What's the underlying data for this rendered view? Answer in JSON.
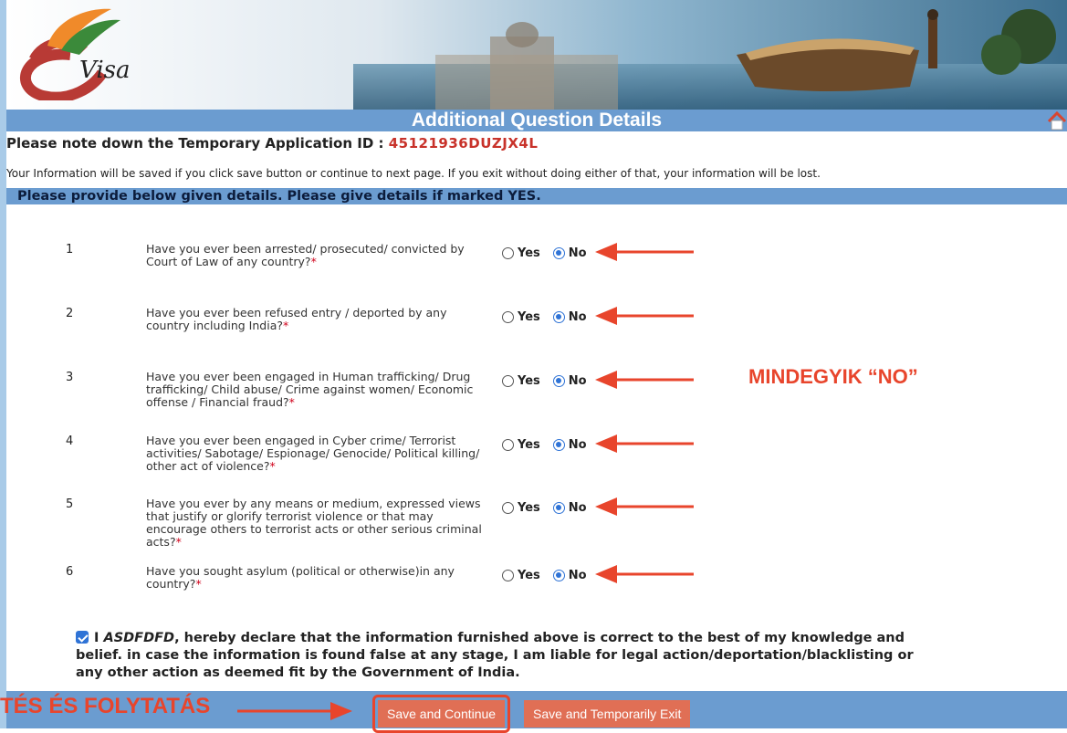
{
  "header": {
    "logo_text": "Visa",
    "title": "Additional Question Details"
  },
  "application": {
    "label": "Please note down the Temporary Application ID :",
    "id": "45121936DUZJX4L"
  },
  "info_note": "Your Information will be saved if you click save button or continue to next page. If you exit without doing either of that, your information will be lost.",
  "section_title": "Please provide below given details. Please give details if marked YES.",
  "options": {
    "yes": "Yes",
    "no": "No"
  },
  "questions": [
    {
      "num": "1",
      "text": "Have you ever been arrested/ prosecuted/ convicted by Court of Law of any country?",
      "answer": "No"
    },
    {
      "num": "2",
      "text": "Have you ever been refused entry / deported by any country including India?",
      "answer": "No"
    },
    {
      "num": "3",
      "text": "Have you ever been engaged in Human trafficking/ Drug trafficking/ Child abuse/ Crime against women/ Economic offense / Financial fraud?",
      "answer": "No"
    },
    {
      "num": "4",
      "text": "Have you ever been engaged in Cyber crime/ Terrorist activities/ Sabotage/ Espionage/ Genocide/ Political killing/ other act of violence?",
      "answer": "No"
    },
    {
      "num": "5",
      "text": "Have you ever by any means or medium, expressed views that justify or glorify terrorist violence or that may encourage others to terrorist acts or other serious criminal acts?",
      "answer": "No"
    },
    {
      "num": "6",
      "text": "Have you sought asylum (political or otherwise)in any country?",
      "answer": "No"
    }
  ],
  "annotations": {
    "side_note": "MINDEGYIK “NO”",
    "footer_note": "TÉS ÉS FOLYTATÁS"
  },
  "declaration": {
    "checked": true,
    "prefix": "I",
    "name": "ASDFDFD",
    "text": ", hereby declare that the information furnished above is correct to the best of my knowledge and belief. in case the information is found false at any stage, I am liable for legal action/deportation/blacklisting or any other action as deemed fit by the Government of India."
  },
  "buttons": {
    "save_continue": "Save and Continue",
    "save_exit": "Save and Temporarily Exit"
  },
  "colors": {
    "header_bar": "#6b9cd0",
    "annotation": "#e8452c",
    "app_id": "#c8322a",
    "button": "#e06f55",
    "radio_selected": "#2f73d6"
  }
}
